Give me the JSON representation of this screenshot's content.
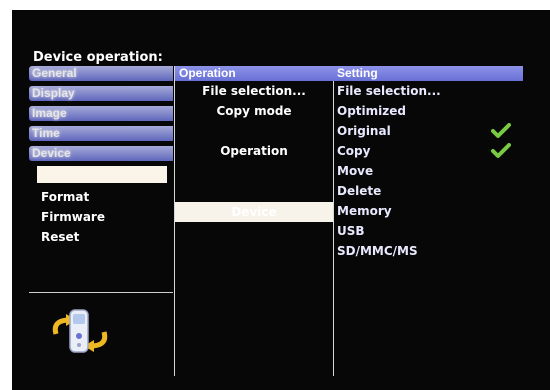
{
  "page_title": "Device operation:",
  "menu": {
    "items": [
      {
        "label": "General"
      },
      {
        "label": "Display"
      },
      {
        "label": "Image"
      },
      {
        "label": "Time"
      },
      {
        "label": "Device"
      }
    ],
    "sub_items": [
      {
        "label": ""
      },
      {
        "label": "Format"
      },
      {
        "label": "Firmware"
      },
      {
        "label": "Reset"
      }
    ]
  },
  "operation": {
    "header": "Operation",
    "rows": [
      {
        "label": "File selection..."
      },
      {
        "label": "Copy mode"
      },
      {
        "label": ""
      },
      {
        "label": "Operation"
      },
      {
        "label": ""
      },
      {
        "label": ""
      },
      {
        "label": "Device"
      }
    ]
  },
  "setting": {
    "header": "Setting",
    "rows": [
      {
        "label": "File selection..."
      },
      {
        "label": "Optimized"
      },
      {
        "label": "Original"
      },
      {
        "label": "Copy"
      },
      {
        "label": "Move"
      },
      {
        "label": "Delete"
      },
      {
        "label": "Memory"
      },
      {
        "label": "USB"
      },
      {
        "label": "SD/MMC/MS"
      }
    ]
  },
  "colors": {
    "menu_gradient_top": "#b8bdf0",
    "menu_gradient_bottom": "#6a72d0",
    "header_blue": "#7a80e0",
    "check_green": "#7ac943",
    "background": "#070707"
  },
  "icons": {
    "device": "card-reader-device-icon",
    "check": "checkmark-icon"
  }
}
